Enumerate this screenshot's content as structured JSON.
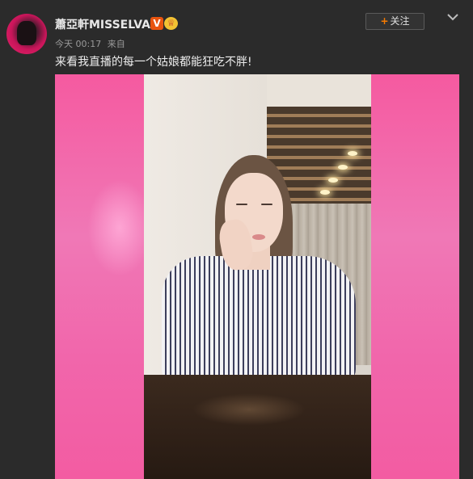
{
  "post": {
    "author": {
      "name": "蕭亞軒MISSELVA",
      "verified_badge": "V",
      "member_badge_icon": "crown-icon"
    },
    "meta": {
      "time": "今天 00:17",
      "source": "来自"
    },
    "follow_button": {
      "plus": "+",
      "label": "关注"
    },
    "more_icon": "chevron-down-icon",
    "text": "来看我直播的每一个姑娘都能狂吃不胖!",
    "media": {
      "type": "video-thumbnail"
    }
  },
  "colors": {
    "background": "#2b2b2b",
    "accent_orange": "#f77b00",
    "verified": "#e8540f",
    "pink_bars": "#f166ab"
  }
}
